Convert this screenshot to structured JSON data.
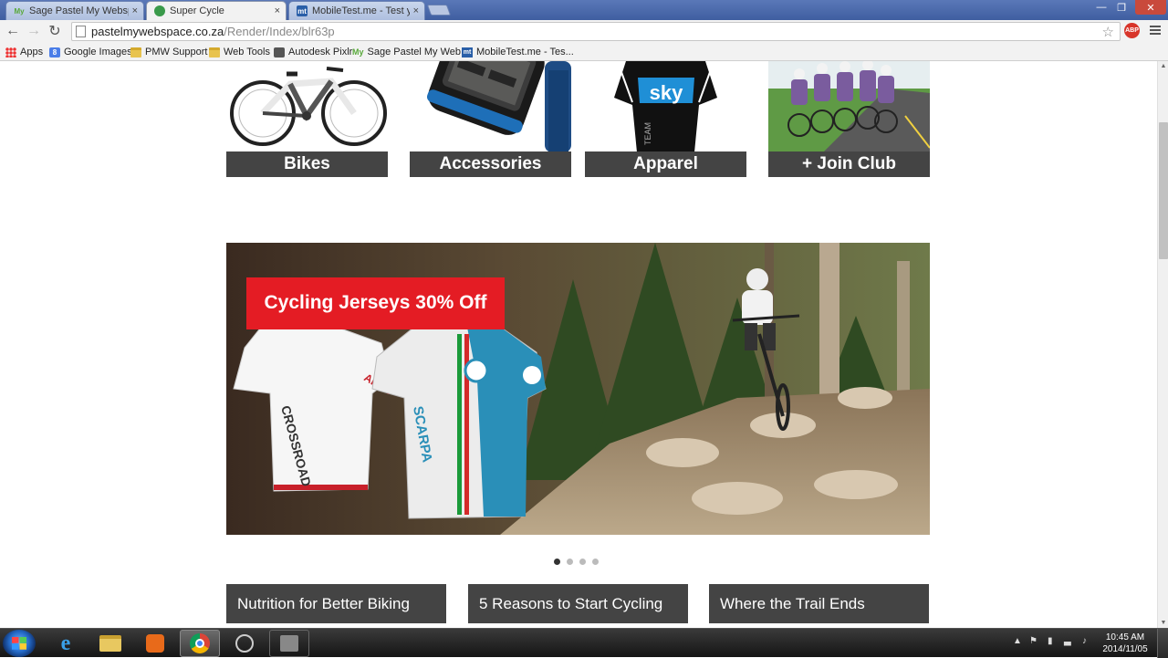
{
  "browser": {
    "tabs": [
      {
        "title": "Sage Pastel My Webspace",
        "fav_text": "My",
        "active": false
      },
      {
        "title": "Super Cycle",
        "fav_text": "",
        "active": true
      },
      {
        "title": "MobileTest.me - Test you",
        "fav_text": "mt",
        "active": false
      }
    ],
    "close_glyph": "×",
    "url_host": "pastelmywebspace.co.za",
    "url_path": "/Render/Index/blr63p",
    "adblock_label": "ABP",
    "bookmarks": [
      {
        "label": "Apps",
        "icon": "apps-grid-icon"
      },
      {
        "label": "Google Images",
        "icon": "google-icon"
      },
      {
        "label": "PMW Support",
        "icon": "folder-icon"
      },
      {
        "label": "Web Tools",
        "icon": "folder-icon"
      },
      {
        "label": "Autodesk Pixlr",
        "icon": "pixlr-icon"
      },
      {
        "label": "Sage Pastel My Web...",
        "icon": "my-webspace-icon"
      },
      {
        "label": "MobileTest.me - Tes...",
        "icon": "mobiletest-icon"
      }
    ]
  },
  "page": {
    "categories": [
      {
        "label": "Bikes"
      },
      {
        "label": "Accessories"
      },
      {
        "label": "Apparel"
      },
      {
        "label": "+ Join Club"
      }
    ],
    "banner": {
      "headline": "Cycling Jerseys 30% Off",
      "slide_count": 4,
      "active_slide": 1
    },
    "articles": [
      {
        "label": "Nutrition for Better Biking"
      },
      {
        "label": "5 Reasons to Start Cycling"
      },
      {
        "label": "Where the Trail Ends"
      }
    ],
    "jersey_brand": "sky"
  },
  "taskbar": {
    "time": "10:45 AM",
    "date": "2014/11/05"
  },
  "colors": {
    "label_bg": "#444444",
    "banner_tag": "#e41c24"
  }
}
